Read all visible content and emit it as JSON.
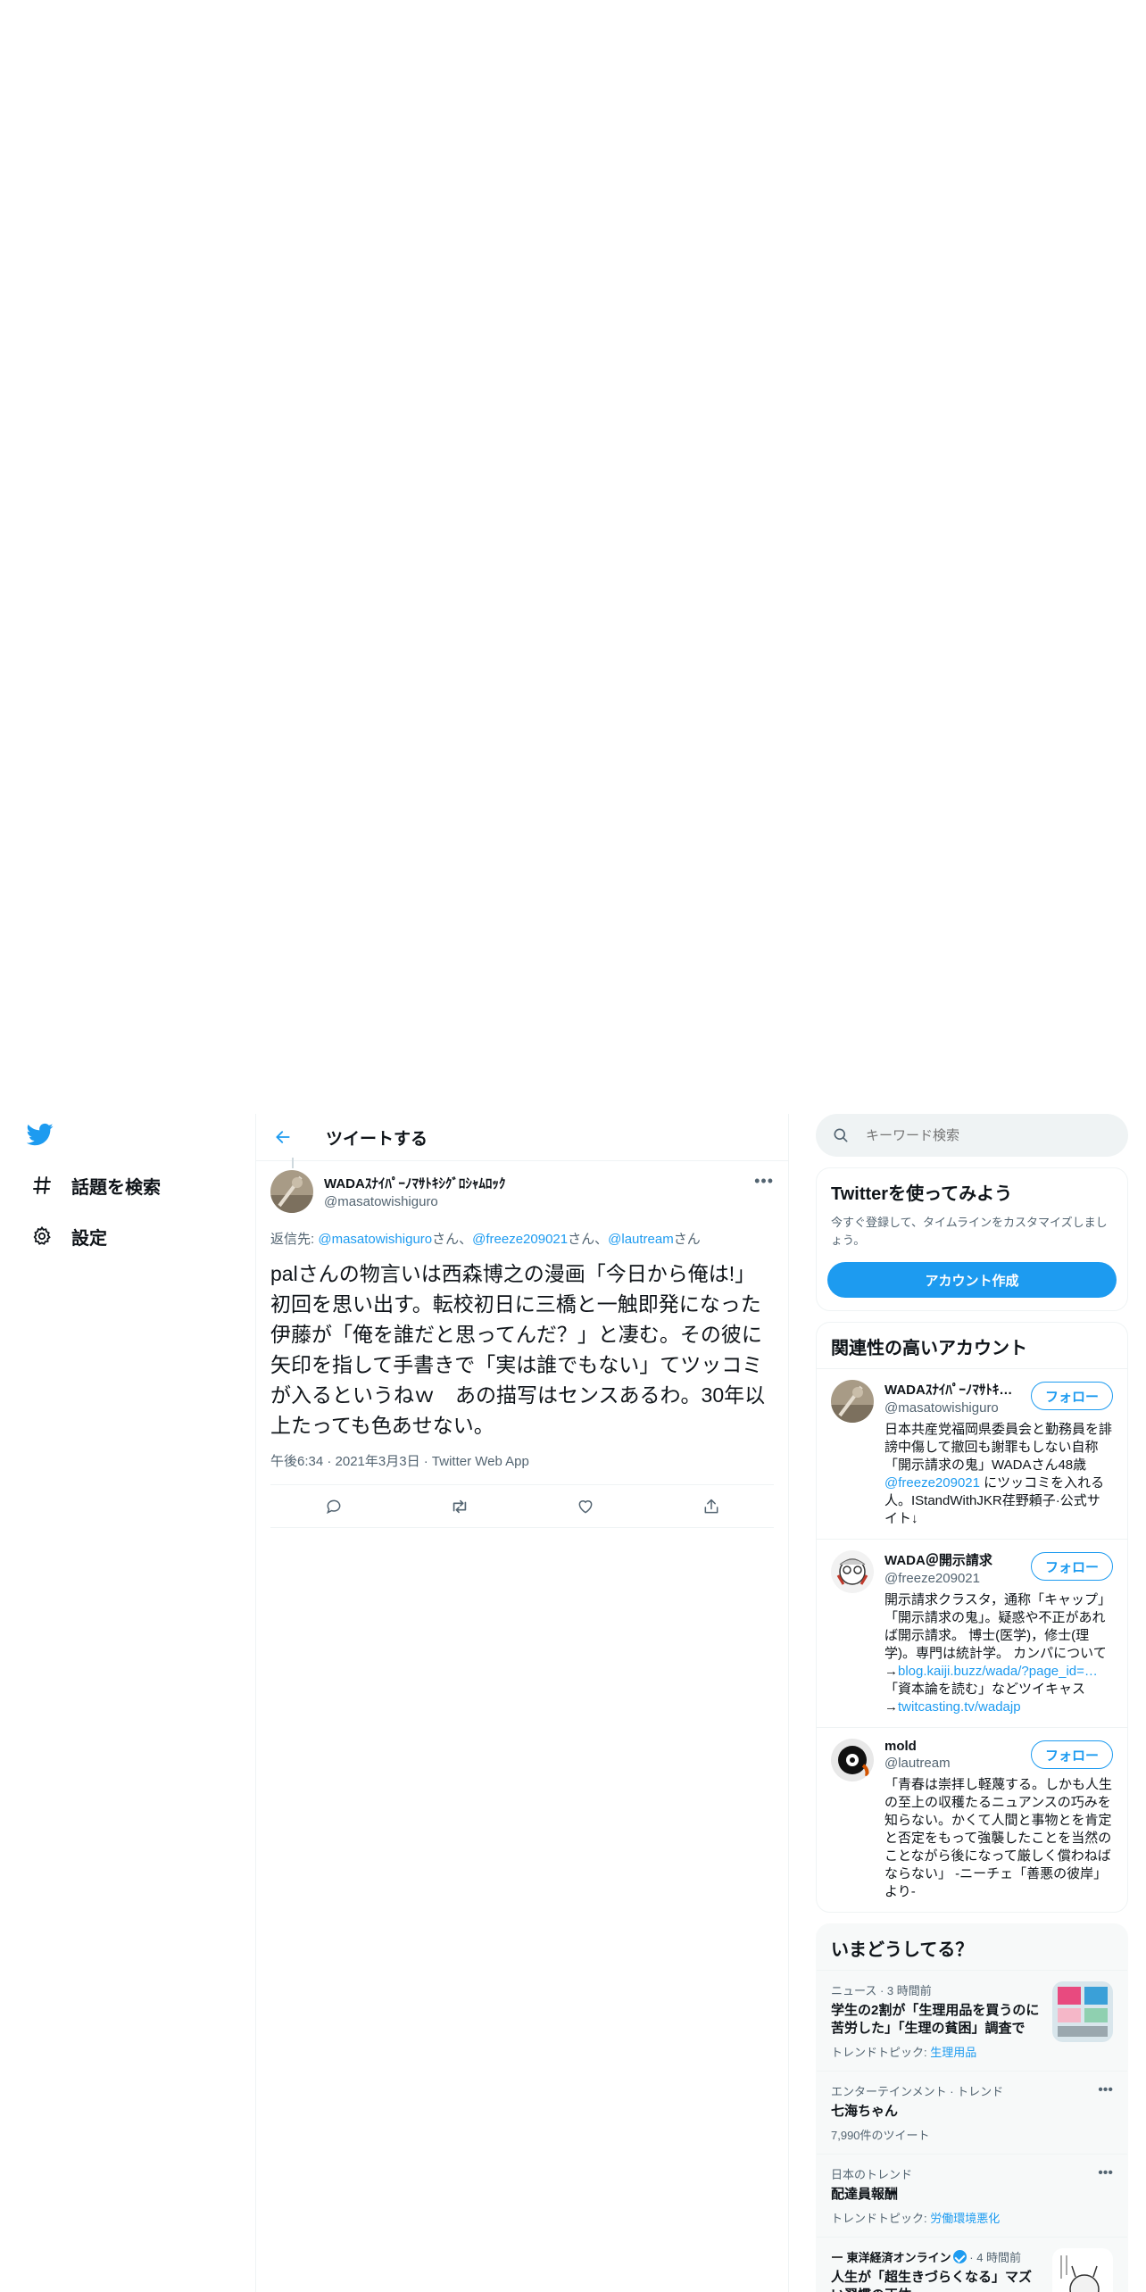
{
  "nav": {
    "items": [
      {
        "label": "話題を検索",
        "icon": "hashtag-icon"
      },
      {
        "label": "設定",
        "icon": "gear-icon"
      }
    ]
  },
  "header": {
    "title": "ツイートする"
  },
  "tweet": {
    "author": {
      "display_name": "WADAｽﾅｲﾊﾟｰﾉﾏｻﾄｷｼｸﾞﾛｼｬﾑﾛｯｸ",
      "handle": "@masatowishiguro"
    },
    "reply_prefix": "返信先: ",
    "reply_mentions": [
      {
        "handle": "@masatowishiguro",
        "suffix": "さん、"
      },
      {
        "handle": "@freeze209021",
        "suffix": "さん、"
      },
      {
        "handle": "@lautream",
        "suffix": "さん"
      }
    ],
    "text": "palさんの物言いは西森博之の漫画「今日から俺は!」初回を思い出す。転校初日に三橋と一触即発になった伊藤が「俺を誰だと思ってんだ？」と凄む。その彼に矢印を指して手書きで「実は誰でもない」てツッコミが入るというねｗ　あの描写はセンスあるわ。30年以上たっても色あせない。",
    "meta": "午後6:34 · 2021年3月3日 · Twitter Web App"
  },
  "search": {
    "placeholder": "キーワード検索"
  },
  "signup": {
    "title": "Twitterを使ってみよう",
    "desc": "今すぐ登録して、タイムラインをカスタマイズしましょう。",
    "button": "アカウント作成"
  },
  "related": {
    "title": "関連性の高いアカウント",
    "follow_label": "フォロー",
    "accounts": [
      {
        "name": "WADAｽﾅｲﾊﾟｰﾉﾏｻﾄｷｼｸﾞﾛｼｬﾑﾛｯｸ",
        "handle": "@masatowishiguro",
        "bio_1": "日本共産党福岡県委員会と勤務員を誹謗中傷して撤回も謝罪もしない自称「開示請求の鬼」WADAさん48歳",
        "bio_link_1": "@freeze209021",
        "bio_2": " にツッコミを入れる人。IStandWithJKR荏野頼子·公式サイト↓"
      },
      {
        "name": "WADA＠開示請求",
        "handle": "@freeze209021",
        "bio_1": "開示請求クラスタ，通称「キャップ」「開示請求の鬼」。疑惑や不正があれば開示請求。 博士(医学)，修士(理学)。専門は統計学。 カンパについて→",
        "bio_link_1": "blog.kaiji.buzz/wada/?page_id=…",
        "bio_2": "「資本論を読む」などツイキャス→",
        "bio_link_2": "twitcasting.tv/wadajp"
      },
      {
        "name": "mold",
        "handle": "@lautream",
        "bio_1": "「青春は崇拝し軽蔑する。しかも人生の至上の収穫たるニュアンスの巧みを知らない。かくて人間と事物とを肯定と否定をもって強襲したことを当然のことながら後になって厳しく償わねばならない」 -ニーチェ「善悪の彼岸」より-"
      }
    ]
  },
  "trends": {
    "title": "いまどうしてる？",
    "items": [
      {
        "context": "ニュース · 3 時間前",
        "title": "学生の2割が「生理用品を買うのに苦労した」「生理の貧困」調査で",
        "sub_prefix": "トレンドトピック: ",
        "topic": "生理用品",
        "thumb": "news-thumbnail"
      },
      {
        "context": "エンターテインメント · トレンド",
        "title": "七海ちゃん",
        "sub": "7,990件のツイート"
      },
      {
        "context": "日本のトレンド",
        "title": "配達員報酬",
        "sub_prefix": "トレンドトピック: ",
        "topic": "労働環境悪化"
      },
      {
        "context_source": "東洋経済オンライン",
        "context_time": " · 4 時間前",
        "title": "人生が「超生きづらくなる」マズい習慣の正体"
      }
    ]
  },
  "colors": {
    "accent": "#1d9bf0",
    "text": "#0f1419",
    "muted": "#536471",
    "border": "#eff3f4"
  }
}
